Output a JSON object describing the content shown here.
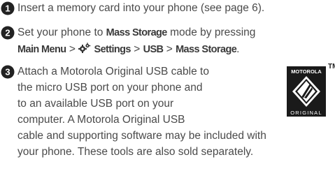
{
  "steps": [
    {
      "number": "1",
      "text": "Insert a memory card into your phone (see page 6)."
    },
    {
      "number": "2",
      "line1_a": "Set your phone to ",
      "line1_b": "Mass Storage",
      "line1_c": " mode by pressing",
      "menu_main": "Main Menu",
      "sep1": " > ",
      "settings_icon": "settings-gear-icon",
      "menu_settings": "Settings",
      "sep2": " > ",
      "menu_usb": "USB",
      "sep3": " > ",
      "menu_mass": "Mass Storage",
      "end": "."
    },
    {
      "number": "3",
      "lines": [
        "Attach a Motorola Original USB cable to",
        "the micro USB port on your phone and",
        "to an available USB port on your",
        "computer. A Motorola Original USB",
        "cable and supporting software may be included with",
        "your phone. These tools are also sold separately."
      ]
    }
  ],
  "logo": {
    "brand": "MOTOROLA",
    "label": "ORIGINAL",
    "tm": "TM"
  },
  "colors": {
    "text": "#4a4a4a",
    "badge": "#222222"
  }
}
